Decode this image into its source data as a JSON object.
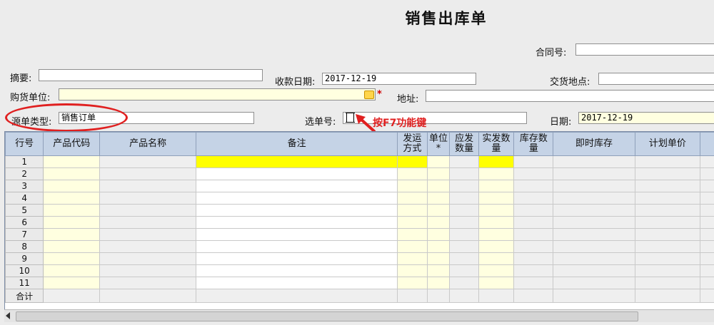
{
  "window": {
    "title": "销售出库单"
  },
  "form": {
    "contract_no": {
      "label": "合同号:",
      "value": ""
    },
    "summary": {
      "label": "摘要:",
      "value": ""
    },
    "payment_date": {
      "label": "收款日期:",
      "value": "2017-12-19"
    },
    "delivery_place": {
      "label": "交货地点:",
      "value": ""
    },
    "buyer": {
      "label": "购货单位:",
      "value": ""
    },
    "address": {
      "label": "地址:",
      "value": ""
    },
    "source_type": {
      "label": "源单类型:",
      "value": "销售订单"
    },
    "select_no": {
      "label": "选单号:",
      "value": ""
    },
    "date": {
      "label": "日期:",
      "value": "2017-12-19"
    }
  },
  "annotation": {
    "hint": "按F7功能键",
    "highlight_color": "#e02020"
  },
  "table": {
    "headers": [
      "行号",
      "产品代码",
      "产品名称",
      "备注",
      "发运\n方式",
      "单位\n*",
      "应发\n数量",
      "实发数\n量",
      "库存数\n量",
      "即时库存",
      "计划单价"
    ],
    "rows": [
      "1",
      "2",
      "3",
      "4",
      "5",
      "6",
      "7",
      "8",
      "9",
      "10",
      "11"
    ],
    "total_label": "合计"
  },
  "colors": {
    "header_bg": "#c5d3e6",
    "required_yellow": "#ffffe0",
    "active_row_highlight": "#ffff00"
  },
  "icons": [
    "lookup-icon",
    "red-arrow-icon",
    "text-cursor-icon",
    "scroll-left-icon"
  ]
}
